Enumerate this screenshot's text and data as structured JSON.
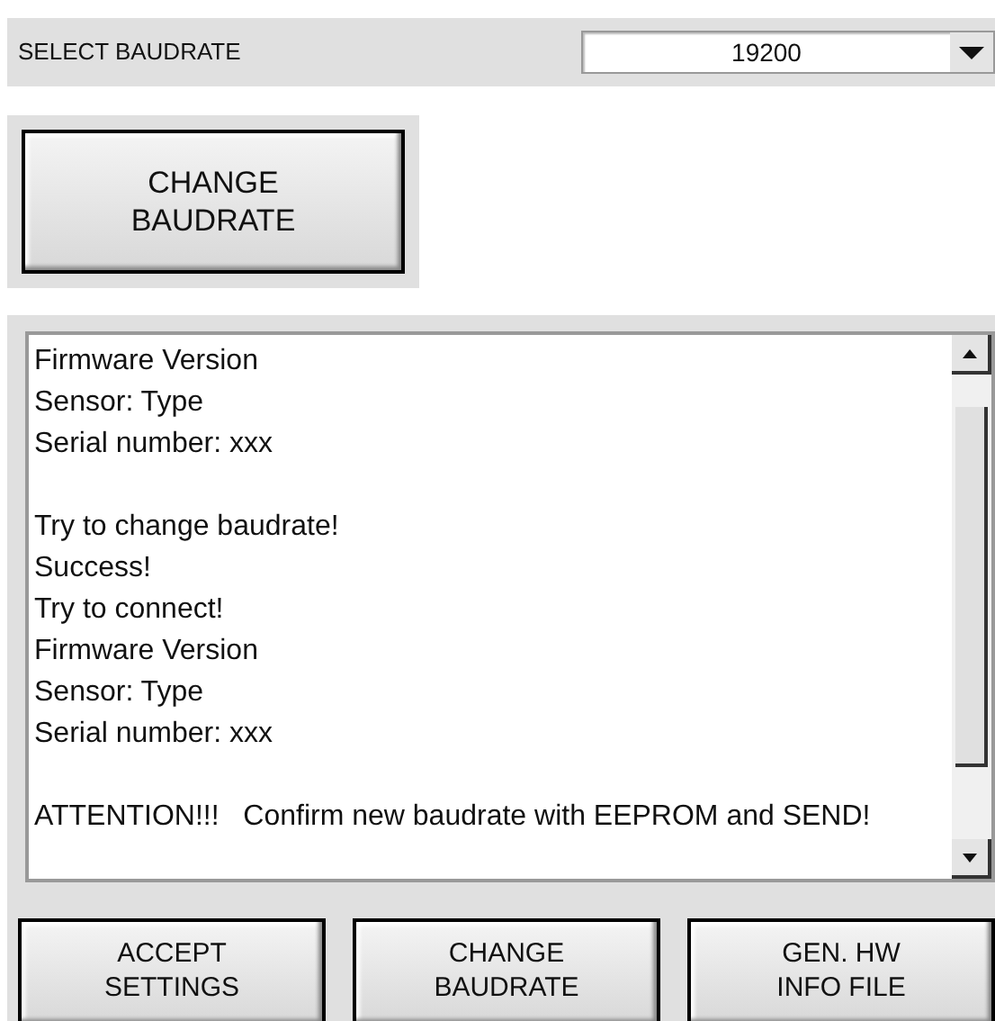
{
  "baudrate": {
    "label": "SELECT BAUDRATE",
    "value": "19200"
  },
  "change_button": {
    "label_lines": [
      "CHANGE",
      "BAUDRATE"
    ]
  },
  "log": {
    "groups": [
      [
        "Firmware Version",
        "Sensor: Type",
        "Serial number: xxx"
      ],
      [
        "Try to change baudrate!",
        "Success!",
        "Try to connect!",
        "Firmware Version",
        "Sensor: Type",
        "Serial number: xxx"
      ],
      [
        "ATTENTION!!!   Confirm new baudrate with EEPROM and SEND!"
      ]
    ]
  },
  "buttons": [
    {
      "label_lines": [
        "ACCEPT",
        "SETTINGS"
      ]
    },
    {
      "label_lines": [
        "CHANGE",
        "BAUDRATE"
      ]
    },
    {
      "label_lines": [
        "GEN. HW",
        "INFO FILE"
      ]
    }
  ]
}
